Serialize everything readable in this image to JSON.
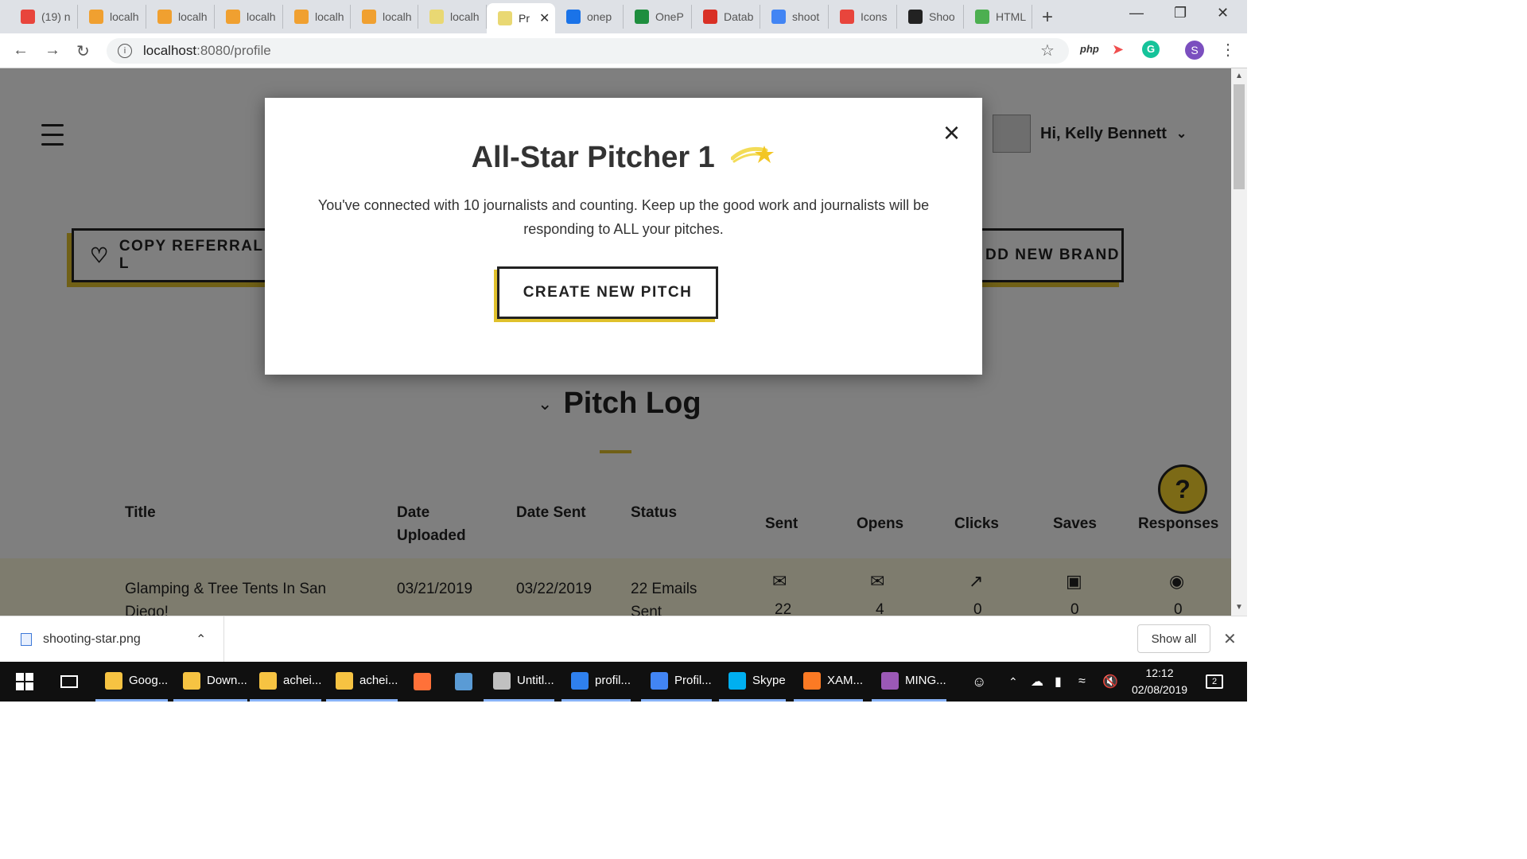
{
  "browser": {
    "tabs": [
      {
        "label": "(19) n",
        "icon": "m-icon",
        "color": "#e8453c"
      },
      {
        "label": "localh",
        "icon": "pma-icon",
        "color": "#f0a030"
      },
      {
        "label": "localh",
        "icon": "pma-icon",
        "color": "#f0a030"
      },
      {
        "label": "localh",
        "icon": "pma-icon",
        "color": "#f0a030"
      },
      {
        "label": "localh",
        "icon": "pma-icon",
        "color": "#f0a030"
      },
      {
        "label": "localh",
        "icon": "pma-icon",
        "color": "#f0a030"
      },
      {
        "label": "localh",
        "icon": "page-icon",
        "color": "#e9d873"
      },
      {
        "label": "Pr",
        "icon": "page-icon",
        "color": "#e9d873",
        "active": true
      },
      {
        "label": "onep",
        "icon": "trello-icon",
        "color": "#1a73e8"
      },
      {
        "label": "OneP",
        "icon": "sheets-icon",
        "color": "#1e8e3e"
      },
      {
        "label": "Datab",
        "icon": "db-icon",
        "color": "#d93025"
      },
      {
        "label": "shoot",
        "icon": "google-icon",
        "color": "#4285f4"
      },
      {
        "label": "Icons",
        "icon": "m-icon",
        "color": "#e8453c"
      },
      {
        "label": "Shoo",
        "icon": "vector-icon",
        "color": "#222222"
      },
      {
        "label": "HTML",
        "icon": "w3-icon",
        "color": "#4caf50"
      }
    ],
    "url_host": "localhost",
    "url_path": ":8080/profile",
    "ext_php": "php",
    "profile_initial": "S"
  },
  "page": {
    "greeting": "Hi, Kelly Bennett",
    "copy_referral": "COPY REFERRAL L",
    "add_brand": "DD NEW BRAND",
    "pitch_log_title": "Pitch Log",
    "help": "?",
    "table_headers": {
      "title": "Title",
      "date_uploaded": "Date Uploaded",
      "date_sent": "Date Sent",
      "status": "Status",
      "sent": "Sent",
      "opens": "Opens",
      "clicks": "Clicks",
      "saves": "Saves",
      "responses": "Responses"
    },
    "row": {
      "title": "Glamping & Tree Tents In San Diego!",
      "date_uploaded": "03/21/2019",
      "date_sent": "03/22/2019",
      "status": "22 Emails Sent",
      "sent": "22",
      "opens": "4",
      "clicks": "0",
      "saves": "0",
      "responses": "0"
    }
  },
  "modal": {
    "title": "All-Star Pitcher 1",
    "body": "You've connected with 10 journalists and counting. Keep up the good work and journalists will be responding to ALL your pitches.",
    "button": "CREATE NEW PITCH",
    "close": "×"
  },
  "download_bar": {
    "filename": "shooting-star.png",
    "show_all": "Show all"
  },
  "taskbar": {
    "items": [
      {
        "label": "Goog...",
        "color": "#f6c342"
      },
      {
        "label": "Down...",
        "color": "#f6c342"
      },
      {
        "label": "achei...",
        "color": "#f6c342"
      },
      {
        "label": "achei...",
        "color": "#f6c342"
      },
      {
        "label": "",
        "color": "#ff7139"
      },
      {
        "label": "",
        "color": "#5a9bd5"
      },
      {
        "label": "Untitl...",
        "color": "#c0c0c0"
      },
      {
        "label": "profil...",
        "color": "#2f80ed"
      },
      {
        "label": "Profil...",
        "color": "#4285f4"
      },
      {
        "label": "Skype",
        "color": "#00aff0"
      },
      {
        "label": "XAM...",
        "color": "#fb7a24"
      },
      {
        "label": "MING...",
        "color": "#9b59b6"
      }
    ],
    "time": "12:12",
    "date": "02/08/2019",
    "notifications": "2"
  }
}
